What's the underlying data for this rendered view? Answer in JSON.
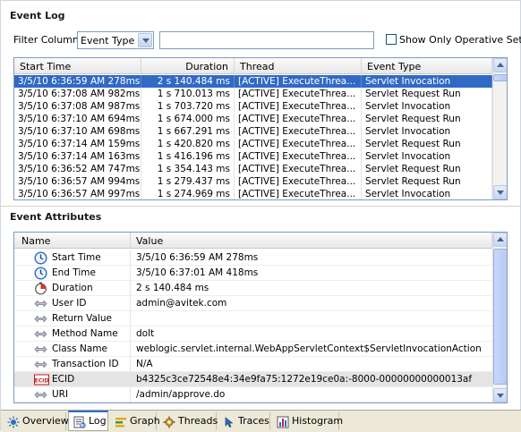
{
  "event_log": {
    "title": "Event Log",
    "filter": {
      "label": "Filter Column",
      "column_value": "Event Type",
      "text_value": "",
      "checkbox_label": "Show Only Operative Set",
      "checked": false
    },
    "columns": [
      "Start Time",
      "Duration",
      "Thread",
      "Event Type"
    ],
    "rows": [
      [
        "3/5/10 6:36:59 AM 278ms",
        "2 s 140.484 ms",
        "[ACTIVE] ExecuteThrea...",
        "Servlet Invocation"
      ],
      [
        "3/5/10 6:37:08 AM 982ms",
        "1 s 710.013 ms",
        "[ACTIVE] ExecuteThrea...",
        "Servlet Request Run"
      ],
      [
        "3/5/10 6:37:08 AM 987ms",
        "1 s 703.720 ms",
        "[ACTIVE] ExecuteThrea...",
        "Servlet Invocation"
      ],
      [
        "3/5/10 6:37:10 AM 694ms",
        "1 s 674.000 ms",
        "[ACTIVE] ExecuteThrea...",
        "Servlet Request Run"
      ],
      [
        "3/5/10 6:37:10 AM 698ms",
        "1 s 667.291 ms",
        "[ACTIVE] ExecuteThrea...",
        "Servlet Invocation"
      ],
      [
        "3/5/10 6:37:14 AM 159ms",
        "1 s 420.820 ms",
        "[ACTIVE] ExecuteThrea...",
        "Servlet Request Run"
      ],
      [
        "3/5/10 6:37:14 AM 163ms",
        "1 s 416.196 ms",
        "[ACTIVE] ExecuteThrea...",
        "Servlet Invocation"
      ],
      [
        "3/5/10 6:36:52 AM 747ms",
        "1 s 354.143 ms",
        "[ACTIVE] ExecuteThrea...",
        "Servlet Request Run"
      ],
      [
        "3/5/10 6:36:57 AM 994ms",
        "1 s 279.437 ms",
        "[ACTIVE] ExecuteThrea...",
        "Servlet Request Run"
      ],
      [
        "3/5/10 6:36:57 AM 997ms",
        "1 s 274.969 ms",
        "[ACTIVE] ExecuteThrea...",
        "Servlet Invocation"
      ]
    ]
  },
  "event_attributes": {
    "title": "Event Attributes",
    "columns": [
      "Name",
      "Value"
    ],
    "rows": [
      {
        "name": "Start Time",
        "value": "3/5/10 6:36:59 AM 278ms",
        "icon": "clock-icon"
      },
      {
        "name": "End Time",
        "value": "3/5/10 6:37:01 AM 418ms",
        "icon": "clock-icon"
      },
      {
        "name": "Duration",
        "value": "2 s 140.484 ms",
        "icon": "stopwatch-icon"
      },
      {
        "name": "User ID",
        "value": "admin@avitek.com",
        "icon": "attribute-icon"
      },
      {
        "name": "Return Value",
        "value": "",
        "icon": "attribute-icon"
      },
      {
        "name": "Method Name",
        "value": "doIt",
        "icon": "attribute-icon"
      },
      {
        "name": "Class Name",
        "value": "weblogic.servlet.internal.WebAppServletContext$ServletInvocationAction",
        "icon": "attribute-icon"
      },
      {
        "name": "Transaction ID",
        "value": "N/A",
        "icon": "attribute-icon"
      },
      {
        "name": "ECID",
        "value": "b4325c3ce72548e4:34e9fa75:1272e19ce0a:-8000-00000000000013af",
        "icon": "ecid-icon",
        "icon_text": "ECID"
      },
      {
        "name": "URI",
        "value": "/admin/approve.do",
        "icon": "attribute-icon"
      }
    ]
  },
  "tabs": [
    {
      "label": "Overview",
      "icon": "overview-icon"
    },
    {
      "label": "Log",
      "icon": "log-icon",
      "active": true
    },
    {
      "label": "Graph",
      "icon": "graph-icon"
    },
    {
      "label": "Threads",
      "icon": "threads-icon"
    },
    {
      "label": "Traces",
      "icon": "traces-icon"
    },
    {
      "label": "Histogram",
      "icon": "histogram-icon"
    }
  ],
  "colors": {
    "selection": "#316ac5",
    "border": "#7f9db9",
    "tab_bar": "#ece9d8"
  }
}
